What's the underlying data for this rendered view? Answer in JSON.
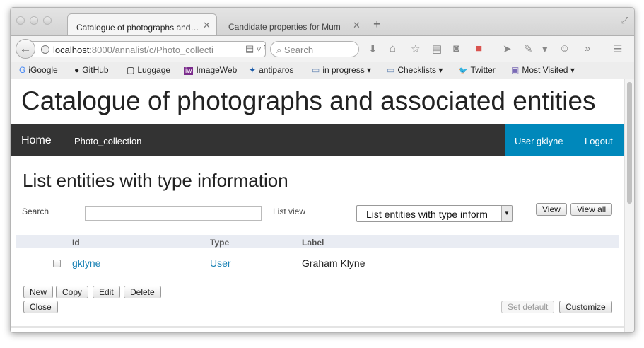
{
  "browser": {
    "tabs": [
      {
        "label": "Catalogue of photographs and…",
        "close": "✕"
      },
      {
        "label": "Candidate properties for Mum",
        "close": "✕"
      }
    ],
    "new_tab": "+",
    "url_host": "localhost",
    "url_rest": ":8000/annalist/c/Photo_collecti",
    "search_placeholder": "Search",
    "bookmarks": [
      {
        "label": "iGoogle",
        "icon": "G"
      },
      {
        "label": "GitHub",
        "icon": "●"
      },
      {
        "label": "Luggage",
        "icon": "▢"
      },
      {
        "label": "ImageWeb",
        "icon": "iw"
      },
      {
        "label": "antiparos",
        "icon": "✦"
      },
      {
        "label": "in progress ▾",
        "icon": "▭"
      },
      {
        "label": "Checklists ▾",
        "icon": "▭"
      },
      {
        "label": "Twitter",
        "icon": "🐦"
      },
      {
        "label": "Most Visited ▾",
        "icon": "▣"
      }
    ]
  },
  "site": {
    "title": "Catalogue of photographs and associated entities",
    "nav": {
      "home": "Home",
      "collection": "Photo_collection",
      "user": "User gklyne",
      "logout": "Logout"
    }
  },
  "page": {
    "heading": "List entities with type information",
    "search_label": "Search",
    "search_value": "",
    "list_view_label": "List view",
    "list_view_value": "List entities with type inform",
    "view_button": "View",
    "view_all_button": "View all",
    "columns": {
      "id": "Id",
      "type": "Type",
      "label": "Label"
    },
    "rows": [
      {
        "id": "gklyne",
        "type": "User",
        "label": "Graham Klyne"
      }
    ],
    "buttons": {
      "new": "New",
      "copy": "Copy",
      "edit": "Edit",
      "delete": "Delete",
      "close": "Close",
      "set_default": "Set default",
      "customize": "Customize"
    }
  },
  "colors": {
    "nav_bg": "#333333",
    "user_bg": "#0088bb",
    "link": "#1a82b5"
  }
}
